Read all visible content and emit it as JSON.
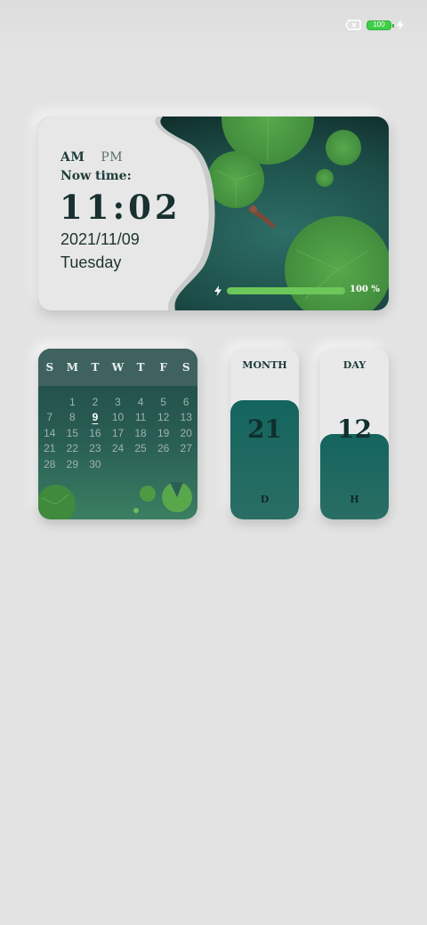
{
  "status_bar": {
    "battery_level": "100",
    "icons": [
      "sim-off-icon",
      "battery-icon",
      "charging-bolt-icon"
    ],
    "battery_color": "#3fcf47"
  },
  "clock_widget": {
    "am_label": "AM",
    "pm_label": "PM",
    "now_label": "Now time:",
    "time": "11:02",
    "date": "2021/11/09",
    "weekday": "Tuesday",
    "charge_percent_label": "100 %",
    "charge_level": 1.0,
    "accent_color": "#6bc75a",
    "pond_color": "#1c4a45"
  },
  "calendar_widget": {
    "weekday_headers": [
      "S",
      "M",
      "T",
      "W",
      "T",
      "F",
      "S"
    ],
    "days": [
      "",
      "1",
      "2",
      "3",
      "4",
      "5",
      "6",
      "7",
      "8",
      "9",
      "10",
      "11",
      "12",
      "13",
      "14",
      "15",
      "16",
      "17",
      "18",
      "19",
      "20",
      "21",
      "22",
      "23",
      "24",
      "25",
      "26",
      "27",
      "28",
      "29",
      "30",
      "",
      "",
      "",
      ""
    ],
    "today": "9"
  },
  "month_widget": {
    "label": "MONTH",
    "value": "21",
    "unit": "D",
    "fill_level": 0.7
  },
  "day_widget": {
    "label": "DAY",
    "value": "12",
    "unit": "H",
    "fill_level": 0.5
  }
}
